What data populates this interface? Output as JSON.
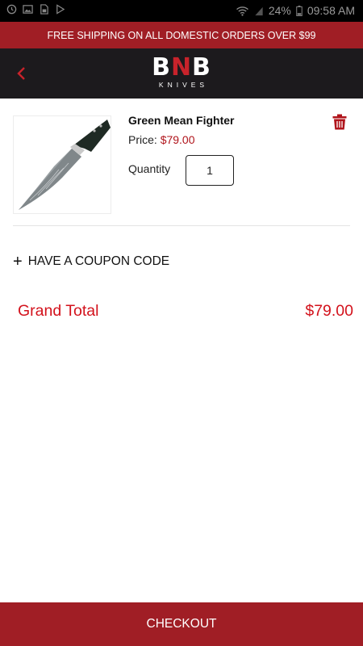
{
  "status_bar": {
    "battery": "24%",
    "time": "09:58 AM",
    "icons": [
      "clock-icon",
      "image-icon",
      "sim-icon",
      "play-store-icon",
      "wifi-icon",
      "signal-icon",
      "battery-icon"
    ]
  },
  "promo_banner": {
    "text": "FREE SHIPPING ON ALL DOMESTIC ORDERS OVER $99"
  },
  "header": {
    "back_icon": "chevron-left-icon",
    "logo": {
      "main_prefix": "B",
      "main_accent": "N",
      "main_suffix": "B",
      "sub": "KNIVES"
    }
  },
  "cart": {
    "items": [
      {
        "name": "Green Mean Fighter",
        "price_label": "Price:",
        "price_value": "$79.00",
        "quantity_label": "Quantity",
        "quantity_value": "1",
        "image": "knife-product-image",
        "delete_icon": "trash-icon"
      }
    ]
  },
  "coupon": {
    "icon": "plus-icon",
    "label": "HAVE A COUPON CODE"
  },
  "totals": {
    "label": "Grand Total",
    "value": "$79.00"
  },
  "checkout": {
    "label": "CHECKOUT"
  },
  "colors": {
    "brand_red": "#a01e25",
    "accent_red": "#d3121c",
    "header_dark": "#1c1a1d"
  }
}
